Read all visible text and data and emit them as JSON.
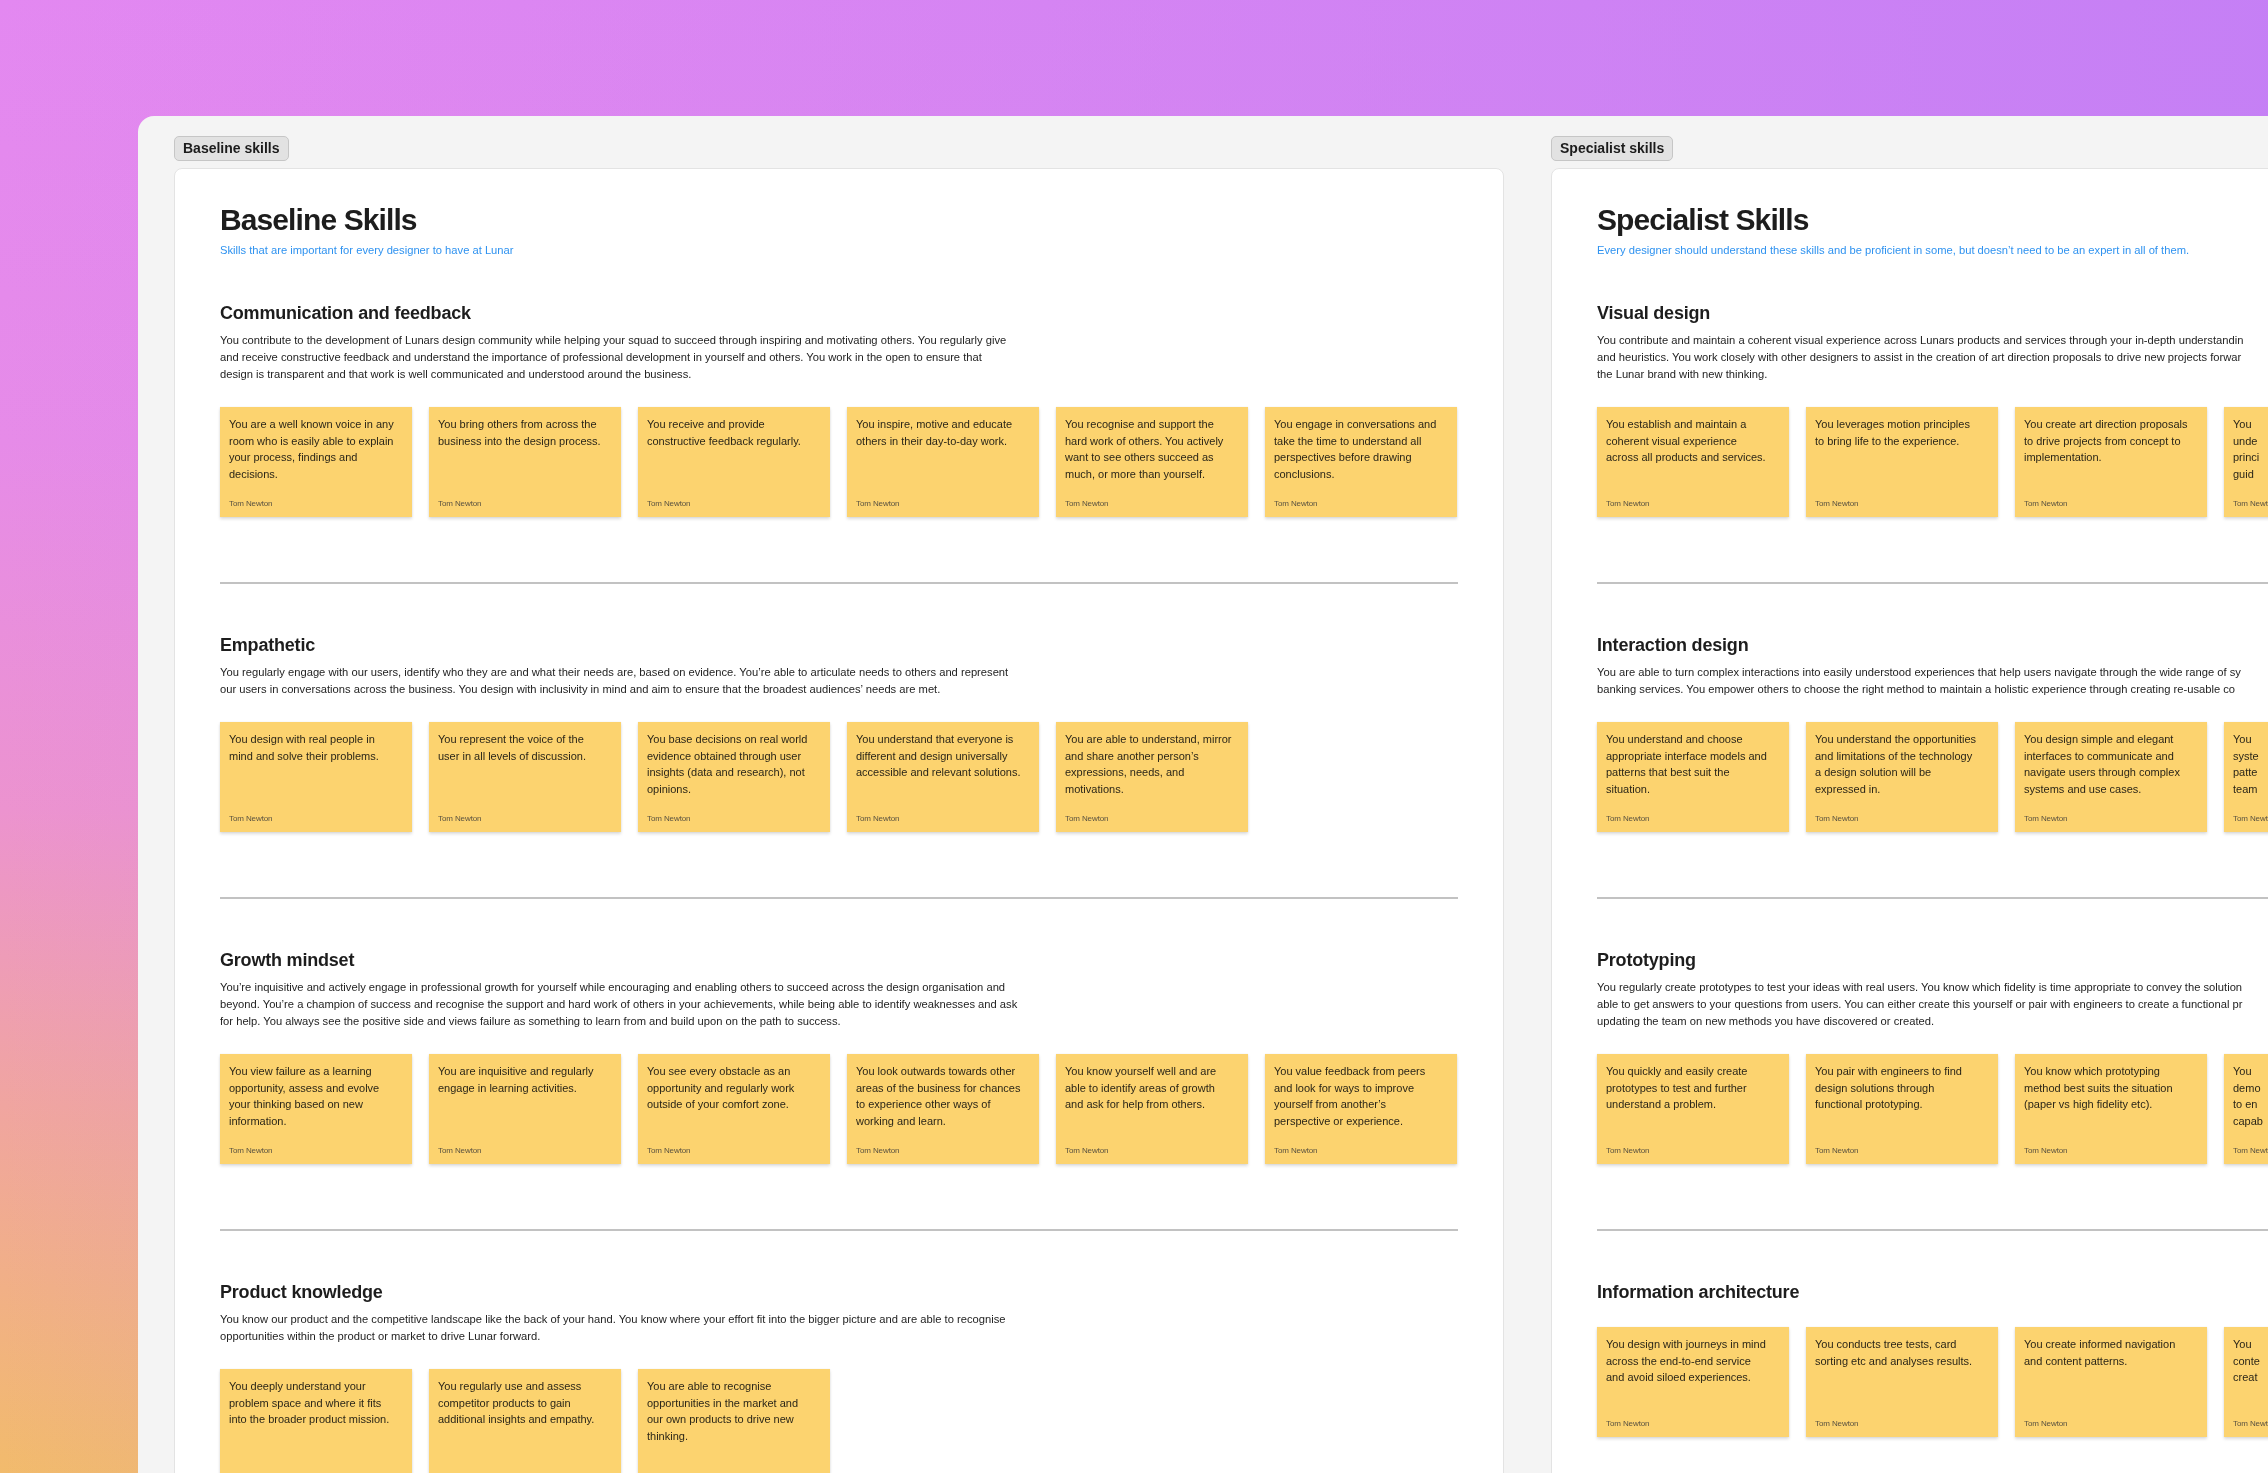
{
  "boards": [
    {
      "label": "Baseline skills",
      "title": "Baseline Skills",
      "subtitle": "Skills that are important for every designer to have at Lunar",
      "sections": [
        {
          "heading": "Communication and feedback",
          "description": [
            "You contribute to the development of Lunars design community while helping your squad to succeed through inspiring and motivating others. You regularly give",
            "and receive constructive feedback and understand the importance of professional development in yourself and others. You work in the open to ensure that",
            "design is transparent and that work is well communicated and understood around the business."
          ],
          "notes": [
            {
              "text": "You are a well known voice in any\nroom who is easily able to explain\nyour process, findings and\ndecisions.",
              "author": "Tom Newton"
            },
            {
              "text": "You bring others from across the\nbusiness into the design process.",
              "author": "Tom Newton"
            },
            {
              "text": "You receive and provide\nconstructive feedback regularly.",
              "author": "Tom Newton"
            },
            {
              "text": "You inspire, motive and educate\nothers in their day-to-day work.",
              "author": "Tom Newton"
            },
            {
              "text": "You recognise and support the\nhard work of others. You actively\nwant to see others succeed as\nmuch, or more than yourself.",
              "author": "Tom Newton"
            },
            {
              "text": "You engage in conversations and\ntake the time to understand all\nperspectives before drawing\nconclusions.",
              "author": "Tom Newton"
            }
          ]
        },
        {
          "heading": "Empathetic",
          "description": [
            "You regularly engage with our users, identify who they are and what their needs are, based on evidence. You’re able to articulate needs to others and represent",
            "our users in conversations across the business. You design with inclusivity in mind and aim to ensure that the broadest audiences’ needs are met."
          ],
          "notes": [
            {
              "text": "You design with real people in\nmind and solve their problems.",
              "author": "Tom Newton"
            },
            {
              "text": "You represent the voice of the\nuser in all levels of discussion.",
              "author": "Tom Newton"
            },
            {
              "text": "You base decisions on real world\nevidence obtained through user\ninsights (data and research), not\nopinions.",
              "author": "Tom Newton"
            },
            {
              "text": "You understand that everyone is\ndifferent and design universally\naccessible and relevant solutions.",
              "author": "Tom Newton"
            },
            {
              "text": "You are able to understand, mirror\nand share another person’s\nexpressions, needs, and\nmotivations.",
              "author": "Tom Newton"
            }
          ]
        },
        {
          "heading": "Growth mindset",
          "description": [
            "You’re inquisitive and actively engage in professional growth for yourself while encouraging and enabling others to succeed across the design organisation and",
            "beyond. You’re a champion of success and recognise the support and hard work of others in your achievements, while being able to identify weaknesses and ask",
            "for help. You always see the positive side and views failure as something to learn from and build upon on the path to success."
          ],
          "notes": [
            {
              "text": "You view failure as a learning\nopportunity, assess and evolve\nyour thinking based on new\ninformation.",
              "author": "Tom Newton"
            },
            {
              "text": "You are inquisitive and regularly\nengage in learning activities.",
              "author": "Tom Newton"
            },
            {
              "text": "You see every obstacle as an\nopportunity and regularly work\noutside of your comfort zone.",
              "author": "Tom Newton"
            },
            {
              "text": "You look outwards towards other\nareas of the business for chances\nto experience other ways of\nworking and learn.",
              "author": "Tom Newton"
            },
            {
              "text": "You know yourself well and are\nable to identify areas of growth\nand ask for help from others.",
              "author": "Tom Newton"
            },
            {
              "text": "You value feedback from peers\nand look for ways to improve\nyourself from another’s\nperspective or experience.",
              "author": "Tom Newton"
            }
          ]
        },
        {
          "heading": "Product knowledge",
          "description": [
            "You know our product and the competitive landscape like the back of your hand. You know where your effort fit into the bigger picture and are able to recognise",
            "opportunities within the product or market to drive Lunar forward."
          ],
          "notes": [
            {
              "text": "You deeply understand your\nproblem space and where it fits\ninto the broader product mission."
            },
            {
              "text": "You regularly use and assess\ncompetitor products to gain\nadditional insights and empathy."
            },
            {
              "text": "You are able to recognise\nopportunities in the market and\nour own products to drive new\nthinking."
            }
          ]
        }
      ]
    },
    {
      "label": "Specialist skills",
      "title": "Specialist Skills",
      "subtitle": "Every designer should understand these skills and be proficient in some, but doesn’t need to be an expert in all of them.",
      "sections": [
        {
          "heading": "Visual design",
          "description": [
            "You contribute and maintain a coherent visual experience across Lunars products and services through your in-depth understandin",
            "and heuristics. You work closely with other designers to assist in the creation of art direction proposals to drive new projects forwar",
            "the Lunar brand with new thinking."
          ],
          "notes": [
            {
              "text": "You establish and maintain a\ncoherent visual experience\nacross all products and services.",
              "author": "Tom Newton"
            },
            {
              "text": "You leverages motion principles\nto bring life to the experience.",
              "author": "Tom Newton"
            },
            {
              "text": "You create art direction proposals\nto drive projects from concept to\nimplementation.",
              "author": "Tom Newton"
            },
            {
              "text": "You\nunde\nprinci\nguid",
              "author": "Tom Newt"
            }
          ]
        },
        {
          "heading": "Interaction design",
          "description": [
            "You are able to turn complex interactions into easily understood experiences that help users navigate through the wide range of sy",
            "banking services. You empower others to choose the right method to maintain a holistic experience through creating re-usable co"
          ],
          "notes": [
            {
              "text": "You understand and choose\nappropriate interface models and\npatterns that best suit the\nsituation.",
              "author": "Tom Newton"
            },
            {
              "text": "You understand the opportunities\nand limitations of the technology\na design solution will be\nexpressed in.",
              "author": "Tom Newton"
            },
            {
              "text": "You design simple and elegant\ninterfaces to communicate and\nnavigate users through complex\nsystems and use cases.",
              "author": "Tom Newton"
            },
            {
              "text": "You\nsyste\npatte\nteam",
              "author": "Tom Newt"
            }
          ]
        },
        {
          "heading": "Prototyping",
          "description": [
            "You regularly create prototypes to test your ideas with real users. You know which fidelity is time appropriate to convey the solution",
            "able to get answers to your questions from users. You can either create this yourself or pair with engineers to create a functional pr",
            "updating the team on new methods you have discovered or created."
          ],
          "notes": [
            {
              "text": "You quickly and easily create\nprototypes to test and further\nunderstand a problem.",
              "author": "Tom Newton"
            },
            {
              "text": "You pair with engineers to find\ndesign solutions through\nfunctional prototyping.",
              "author": "Tom Newton"
            },
            {
              "text": "You know which prototyping\nmethod best suits the situation\n(paper vs high fidelity etc).",
              "author": "Tom Newton"
            },
            {
              "text": "You\ndemo\nto en\ncapab",
              "author": "Tom Newt"
            }
          ]
        },
        {
          "heading": "Information architecture",
          "notes": [
            {
              "text": "You design with journeys in mind\nacross the end-to-end service\nand avoid siloed experiences.",
              "author": "Tom Newton"
            },
            {
              "text": "You conducts tree tests, card\nsorting etc and analyses results.",
              "author": "Tom Newton"
            },
            {
              "text": "You create informed navigation\nand content patterns.",
              "author": "Tom Newton"
            },
            {
              "text": "You\nconte\ncreat",
              "author": "Tom Newt"
            }
          ]
        }
      ]
    }
  ]
}
